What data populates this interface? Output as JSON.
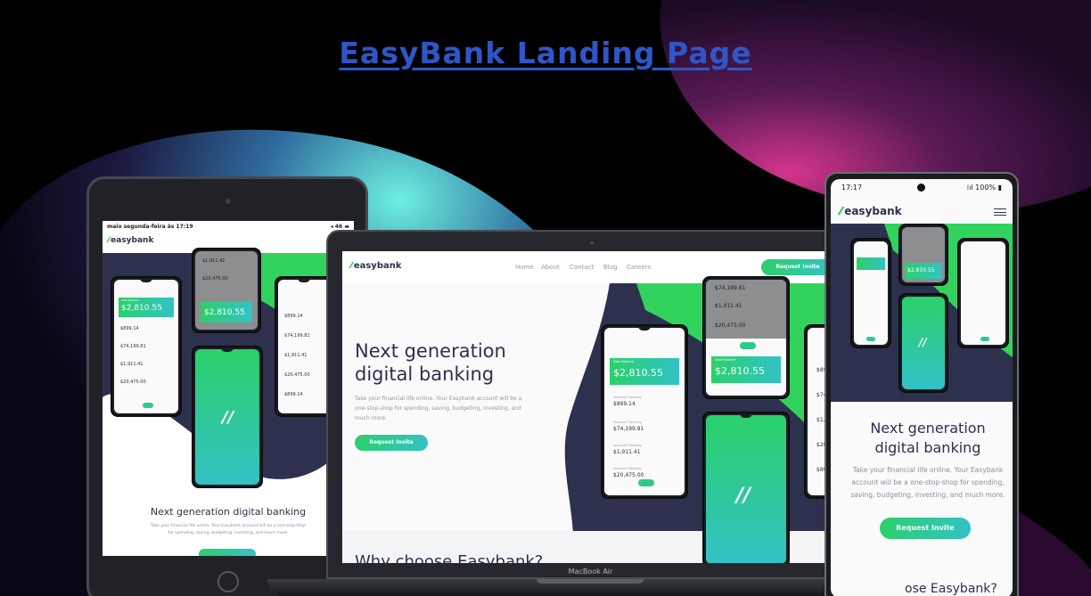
{
  "page": {
    "title": "EasyBank Landing Page"
  },
  "logo": {
    "text": "easybank"
  },
  "tablet": {
    "status": "maio segunda-feira às 17:19",
    "signal": "◂ 46 ▬",
    "headline": "Next generation digital banking",
    "body1": "Take your financial life online. Your Easybank account will be a one-stop-shop",
    "body2": "for spending, saving, budgeting, investing, and much more."
  },
  "laptop": {
    "nav": [
      "Home",
      "About",
      "Contact",
      "Blog",
      "Careers"
    ],
    "cta": "Request Invite",
    "hero1": "Next generation",
    "hero2": "digital banking",
    "body1": "Take your financial life online. Your Easybank account will be a",
    "body2": "one-stop-shop for spending, saving, budgeting, investing, and",
    "body3": "much more.",
    "hero_cta": "Request Invite",
    "section": "Why choose Easybank?",
    "device_label": "MacBook Air"
  },
  "phone": {
    "time": "17:17",
    "battery": "⁞ıl 100% ▮",
    "hero1": "Next generation",
    "hero2": "digital banking",
    "body1": "Take your financial life online. Your Easybank",
    "body2": "account will be a one-stop-shop for spending,",
    "body3": "saving, budgeting, investing, and much more.",
    "cta": "Request Invite",
    "peek": "ose Easybank?"
  },
  "mockup": {
    "card_label": "Total Balance",
    "balance": "$2,810.55",
    "rows": [
      {
        "label": "Account Checking",
        "amount": "$899.14"
      },
      {
        "label": "Account Checking",
        "amount": "$74,199.81"
      },
      {
        "label": "Account Checking",
        "amount": "$1,911.41"
      },
      {
        "label": "Account Checking",
        "amount": "$20,475.00"
      }
    ]
  },
  "colors": {
    "title": "#2f56c8",
    "green": "#31d35c",
    "cyan": "#33c2c6",
    "navy": "#2d314d"
  }
}
